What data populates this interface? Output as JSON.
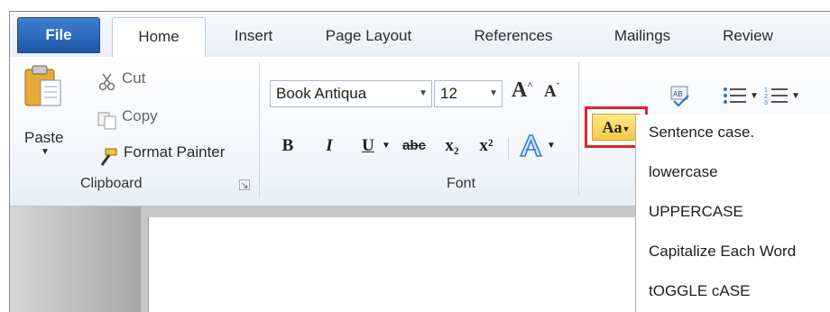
{
  "tabs": [
    {
      "label": "File"
    },
    {
      "label": "Home"
    },
    {
      "label": "Insert"
    },
    {
      "label": "Page Layout"
    },
    {
      "label": "References"
    },
    {
      "label": "Mailings"
    },
    {
      "label": "Review"
    }
  ],
  "clipboard": {
    "paste_label": "Paste",
    "cut_label": "Cut",
    "copy_label": "Copy",
    "format_painter_label": "Format Painter",
    "group_label": "Clipboard"
  },
  "font": {
    "font_name": "Book Antiqua",
    "font_size": "12",
    "grow_label": "A",
    "shrink_label": "A",
    "bold_label": "B",
    "italic_label": "I",
    "underline_label": "U",
    "strike_label": "abc",
    "subscript_label": "x₂",
    "superscript_label": "x²",
    "group_label": "Font"
  },
  "change_case": {
    "button_label": "Aa",
    "menu_items": [
      "Sentence case.",
      "lowercase",
      "UPPERCASE",
      "Capitalize Each Word",
      "tOGGLE cASE"
    ]
  },
  "colors": {
    "highlight_border": "#e0262b",
    "file_tab": "#1d56a7",
    "button_gold": "#f7c843"
  }
}
